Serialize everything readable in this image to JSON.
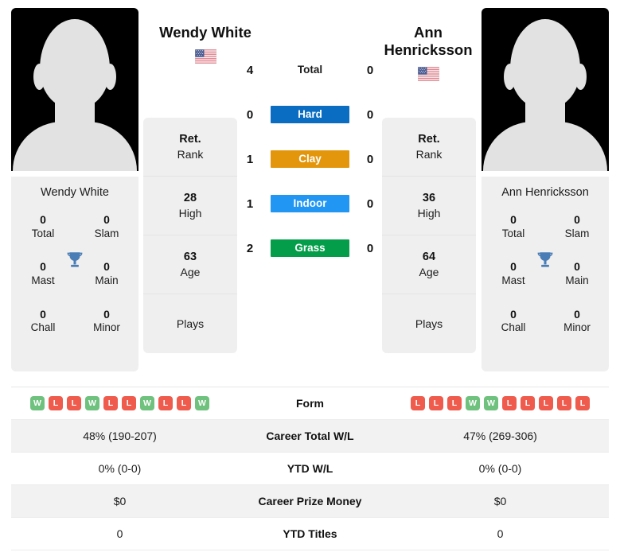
{
  "players": {
    "left": {
      "name": "Wendy White",
      "name_lines": [
        "Wendy White"
      ],
      "photo_caption": "Wendy White",
      "flag": "us-flag-icon",
      "titles": [
        {
          "value": "0",
          "label": "Total"
        },
        {
          "value": "0",
          "label": "Slam"
        },
        {
          "value": "0",
          "label": "Mast"
        },
        {
          "value": "0",
          "label": "Main"
        },
        {
          "value": "0",
          "label": "Chall"
        },
        {
          "value": "0",
          "label": "Minor"
        }
      ],
      "stats": [
        {
          "value": "Ret.",
          "label": "Rank"
        },
        {
          "value": "28",
          "label": "High"
        },
        {
          "value": "63",
          "label": "Age"
        },
        {
          "value": "",
          "label": "Plays"
        }
      ],
      "form": [
        "W",
        "L",
        "L",
        "W",
        "L",
        "L",
        "W",
        "L",
        "L",
        "W"
      ]
    },
    "right": {
      "name": "Ann Henricksson",
      "name_lines": [
        "Ann",
        "Henricksson"
      ],
      "photo_caption": "Ann Henricksson",
      "flag": "us-flag-icon",
      "titles": [
        {
          "value": "0",
          "label": "Total"
        },
        {
          "value": "0",
          "label": "Slam"
        },
        {
          "value": "0",
          "label": "Mast"
        },
        {
          "value": "0",
          "label": "Main"
        },
        {
          "value": "0",
          "label": "Chall"
        },
        {
          "value": "0",
          "label": "Minor"
        }
      ],
      "stats": [
        {
          "value": "Ret.",
          "label": "Rank"
        },
        {
          "value": "36",
          "label": "High"
        },
        {
          "value": "64",
          "label": "Age"
        },
        {
          "value": "",
          "label": "Plays"
        }
      ],
      "form": [
        "L",
        "L",
        "L",
        "W",
        "W",
        "L",
        "L",
        "L",
        "L",
        "L"
      ]
    }
  },
  "surfaces": [
    {
      "label": "Total",
      "left": "4",
      "right": "0",
      "color": "",
      "plain": true
    },
    {
      "label": "Hard",
      "left": "0",
      "right": "0",
      "color": "#0b6dc2",
      "plain": false
    },
    {
      "label": "Clay",
      "left": "1",
      "right": "0",
      "color": "#e3960b",
      "plain": false
    },
    {
      "label": "Indoor",
      "left": "1",
      "right": "0",
      "color": "#2196f3",
      "plain": false
    },
    {
      "label": "Grass",
      "left": "2",
      "right": "0",
      "color": "#049e4a",
      "plain": false
    }
  ],
  "table": [
    {
      "label": "Form",
      "left": "",
      "right": "",
      "type": "form",
      "shade": false
    },
    {
      "label": "Career Total W/L",
      "left": "48% (190-207)",
      "right": "47% (269-306)",
      "type": "text",
      "shade": true
    },
    {
      "label": "YTD W/L",
      "left": "0% (0-0)",
      "right": "0% (0-0)",
      "type": "text",
      "shade": false
    },
    {
      "label": "Career Prize Money",
      "left": "$0",
      "right": "$0",
      "type": "text",
      "shade": true
    },
    {
      "label": "YTD Titles",
      "left": "0",
      "right": "0",
      "type": "text",
      "shade": false
    }
  ],
  "colors": {
    "hard": "#0b6dc2",
    "clay": "#e3960b",
    "indoor": "#2196f3",
    "grass": "#049e4a",
    "win": "#6fc17e",
    "loss": "#ef5b4c",
    "trophy": "#4a7db5",
    "panel": "#efefef"
  }
}
